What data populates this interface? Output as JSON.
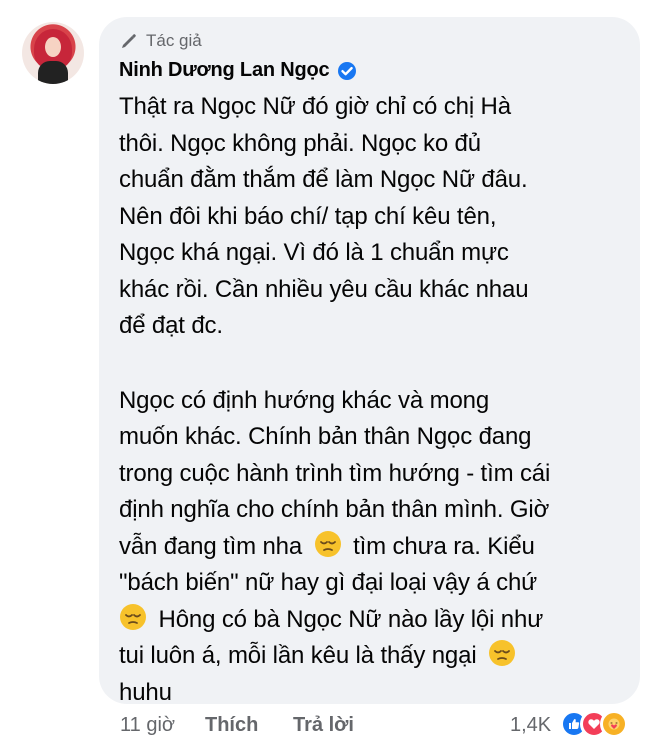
{
  "comment": {
    "author_badge": "Tác giả",
    "author_name": "Ninh Dương Lan Ngọc",
    "paragraph1_lines": [
      "Thật ra Ngọc Nữ đó giờ chỉ có chị Hà",
      "thôi. Ngọc không phải. Ngọc ko đủ",
      "chuẩn đằm thắm để làm Ngọc Nữ đâu.",
      "Nên đôi khi báo chí/ tạp chí kêu tên,",
      "Ngọc khá ngại. Vì đó là 1 chuẩn mực",
      "khác rồi. Cần nhiều yêu cầu khác nhau",
      "để đạt đc."
    ],
    "paragraph2_lines": [
      "Ngọc có định hướng khác và mong",
      "muốn khác. Chính bản thân Ngọc đang",
      "trong cuộc hành trình tìm hướng - tìm cái",
      "định nghĩa cho chính bản thân mình. Giờ"
    ],
    "line12_before": "vẫn đang tìm nha",
    "line12_after": "tìm chưa ra. Kiểu",
    "line13": "\"bách biến\" nữ hay gì đại loại vậy á chứ",
    "line14_after": "Hông có bà Ngọc Nữ nào lầy lội như",
    "line15_before": "tui luôn á, mỗi lần kêu là thấy ngại",
    "line16": "huhu"
  },
  "footer": {
    "time": "11 giờ",
    "like_label": "Thích",
    "reply_label": "Trả lời",
    "reaction_count": "1,4K"
  },
  "icons": {
    "author_icon": "pen-icon",
    "verified_icon": "verified-badge-icon",
    "emoji": "pensive-face-emoji"
  },
  "colors": {
    "bubble": "#f0f2f5",
    "secondary_text": "#65676b",
    "verified_blue": "#1877f2",
    "emoji_yellow": "#f7c22b"
  }
}
